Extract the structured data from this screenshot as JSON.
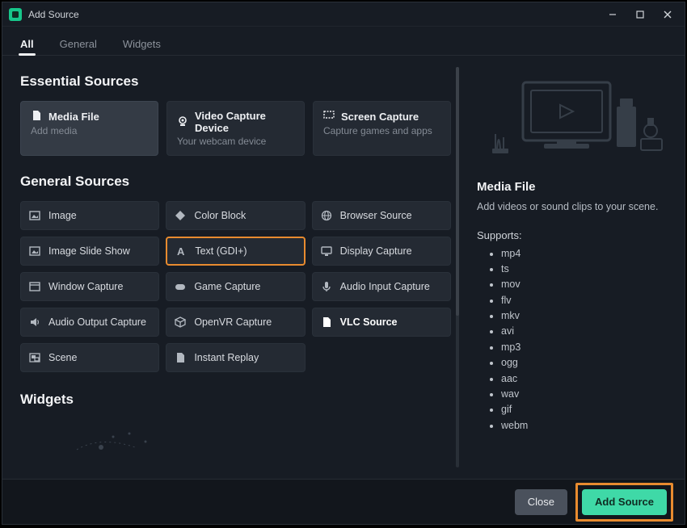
{
  "window": {
    "title": "Add Source"
  },
  "tabs": [
    {
      "label": "All",
      "active": true
    },
    {
      "label": "General",
      "active": false
    },
    {
      "label": "Widgets",
      "active": false
    }
  ],
  "sections": {
    "essential_title": "Essential Sources",
    "general_title": "General Sources",
    "widgets_title": "Widgets"
  },
  "essential": [
    {
      "title": "Media File",
      "sub": "Add media",
      "selected": true,
      "icon": "file-icon"
    },
    {
      "title": "Video Capture Device",
      "sub": "Your webcam device",
      "selected": false,
      "icon": "webcam-icon"
    },
    {
      "title": "Screen Capture",
      "sub": "Capture games and apps",
      "selected": false,
      "icon": "screen-icon"
    }
  ],
  "general": [
    {
      "label": "Image",
      "icon": "image-icon"
    },
    {
      "label": "Color Block",
      "icon": "color-block-icon"
    },
    {
      "label": "Browser Source",
      "icon": "globe-icon"
    },
    {
      "label": "Image Slide Show",
      "icon": "image-icon"
    },
    {
      "label": "Text (GDI+)",
      "icon": "text-icon",
      "highlight": "orange"
    },
    {
      "label": "Display Capture",
      "icon": "monitor-icon"
    },
    {
      "label": "Window Capture",
      "icon": "window-icon"
    },
    {
      "label": "Game Capture",
      "icon": "gamepad-icon"
    },
    {
      "label": "Audio Input Capture",
      "icon": "mic-icon"
    },
    {
      "label": "Audio Output Capture",
      "icon": "speaker-icon"
    },
    {
      "label": "OpenVR Capture",
      "icon": "cube-icon"
    },
    {
      "label": "VLC Source",
      "icon": "file-icon",
      "highlight": "white"
    },
    {
      "label": "Scene",
      "icon": "scene-icon"
    },
    {
      "label": "Instant Replay",
      "icon": "file-icon"
    }
  ],
  "side": {
    "title": "Media File",
    "description": "Add videos or sound clips to your scene.",
    "supports_label": "Supports:",
    "formats": [
      "mp4",
      "ts",
      "mov",
      "flv",
      "mkv",
      "avi",
      "mp3",
      "ogg",
      "aac",
      "wav",
      "gif",
      "webm"
    ]
  },
  "footer": {
    "close": "Close",
    "add": "Add Source"
  }
}
